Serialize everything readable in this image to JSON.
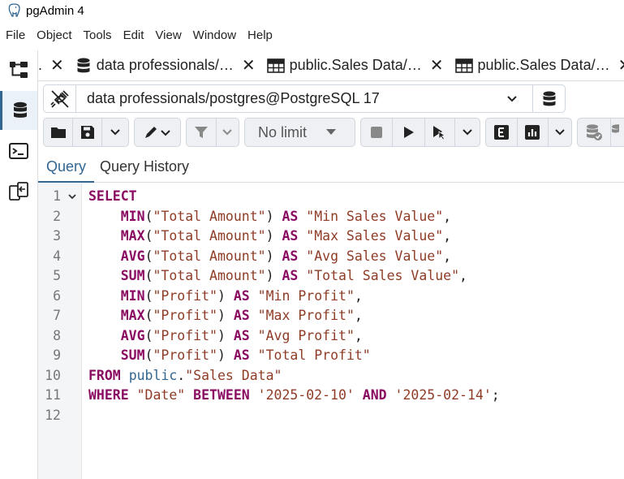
{
  "window": {
    "title": "pgAdmin 4"
  },
  "menu": [
    "File",
    "Object",
    "Tools",
    "Edit",
    "View",
    "Window",
    "Help"
  ],
  "leftbar": {
    "items": [
      {
        "icon": "object-explorer-icon"
      },
      {
        "icon": "query-tool-database-icon",
        "active": true
      },
      {
        "icon": "psql-terminal-icon"
      },
      {
        "icon": "schema-diff-icon"
      }
    ]
  },
  "tabs": [
    {
      "label": ".",
      "icon": "none"
    },
    {
      "label": "data professionals/…",
      "icon": "database-icon"
    },
    {
      "label": "public.Sales Data/…",
      "icon": "table-icon"
    },
    {
      "label": "public.Sales Data/…",
      "icon": "table-icon"
    }
  ],
  "connection": {
    "label": "data professionals/postgres@PostgreSQL 17"
  },
  "toolbar": {
    "limit_label": "No limit"
  },
  "subtabs": {
    "query": "Query",
    "history": "Query History"
  },
  "editor": {
    "lines": [
      {
        "n": "1",
        "tokens": [
          [
            "kw",
            "SELECT"
          ]
        ]
      },
      {
        "n": "2",
        "tokens": [
          [
            "pl",
            "    "
          ],
          [
            "kw",
            "MIN"
          ],
          [
            "pl",
            "("
          ],
          [
            "str",
            "\"Total Amount\""
          ],
          [
            "pl",
            ") "
          ],
          [
            "kw",
            "AS"
          ],
          [
            "pl",
            " "
          ],
          [
            "str",
            "\"Min Sales Value\""
          ],
          [
            "pl",
            ","
          ]
        ]
      },
      {
        "n": "3",
        "tokens": [
          [
            "pl",
            "    "
          ],
          [
            "kw",
            "MAX"
          ],
          [
            "pl",
            "("
          ],
          [
            "str",
            "\"Total Amount\""
          ],
          [
            "pl",
            ") "
          ],
          [
            "kw",
            "AS"
          ],
          [
            "pl",
            " "
          ],
          [
            "str",
            "\"Max Sales Value\""
          ],
          [
            "pl",
            ","
          ]
        ]
      },
      {
        "n": "4",
        "tokens": [
          [
            "pl",
            "    "
          ],
          [
            "kw",
            "AVG"
          ],
          [
            "pl",
            "("
          ],
          [
            "str",
            "\"Total Amount\""
          ],
          [
            "pl",
            ") "
          ],
          [
            "kw",
            "AS"
          ],
          [
            "pl",
            " "
          ],
          [
            "str",
            "\"Avg Sales Value\""
          ],
          [
            "pl",
            ","
          ]
        ]
      },
      {
        "n": "5",
        "tokens": [
          [
            "pl",
            "    "
          ],
          [
            "kw",
            "SUM"
          ],
          [
            "pl",
            "("
          ],
          [
            "str",
            "\"Total Amount\""
          ],
          [
            "pl",
            ") "
          ],
          [
            "kw",
            "AS"
          ],
          [
            "pl",
            " "
          ],
          [
            "str",
            "\"Total Sales Value\""
          ],
          [
            "pl",
            ","
          ]
        ]
      },
      {
        "n": "6",
        "tokens": [
          [
            "pl",
            "    "
          ],
          [
            "kw",
            "MIN"
          ],
          [
            "pl",
            "("
          ],
          [
            "str",
            "\"Profit\""
          ],
          [
            "pl",
            ") "
          ],
          [
            "kw",
            "AS"
          ],
          [
            "pl",
            " "
          ],
          [
            "str",
            "\"Min Profit\""
          ],
          [
            "pl",
            ","
          ]
        ]
      },
      {
        "n": "7",
        "tokens": [
          [
            "pl",
            "    "
          ],
          [
            "kw",
            "MAX"
          ],
          [
            "pl",
            "("
          ],
          [
            "str",
            "\"Profit\""
          ],
          [
            "pl",
            ") "
          ],
          [
            "kw",
            "AS"
          ],
          [
            "pl",
            " "
          ],
          [
            "str",
            "\"Max Profit\""
          ],
          [
            "pl",
            ","
          ]
        ]
      },
      {
        "n": "8",
        "tokens": [
          [
            "pl",
            "    "
          ],
          [
            "kw",
            "AVG"
          ],
          [
            "pl",
            "("
          ],
          [
            "str",
            "\"Profit\""
          ],
          [
            "pl",
            ") "
          ],
          [
            "kw",
            "AS"
          ],
          [
            "pl",
            " "
          ],
          [
            "str",
            "\"Avg Profit\""
          ],
          [
            "pl",
            ","
          ]
        ]
      },
      {
        "n": "9",
        "tokens": [
          [
            "pl",
            "    "
          ],
          [
            "kw",
            "SUM"
          ],
          [
            "pl",
            "("
          ],
          [
            "str",
            "\"Profit\""
          ],
          [
            "pl",
            ") "
          ],
          [
            "kw",
            "AS"
          ],
          [
            "pl",
            " "
          ],
          [
            "str",
            "\"Total Profit\""
          ]
        ]
      },
      {
        "n": "10",
        "tokens": [
          [
            "kw",
            "FROM"
          ],
          [
            "pl",
            " "
          ],
          [
            "id",
            "public"
          ],
          [
            "pl",
            "."
          ],
          [
            "str",
            "\"Sales Data\""
          ]
        ]
      },
      {
        "n": "11",
        "tokens": [
          [
            "kw",
            "WHERE"
          ],
          [
            "pl",
            " "
          ],
          [
            "str",
            "\"Date\""
          ],
          [
            "pl",
            " "
          ],
          [
            "kw",
            "BETWEEN"
          ],
          [
            "pl",
            " "
          ],
          [
            "str",
            "'2025-02-10'"
          ],
          [
            "pl",
            " "
          ],
          [
            "kw",
            "AND"
          ],
          [
            "pl",
            " "
          ],
          [
            "str",
            "'2025-02-14'"
          ],
          [
            "pl",
            ";"
          ]
        ]
      },
      {
        "n": "12",
        "tokens": []
      }
    ]
  }
}
